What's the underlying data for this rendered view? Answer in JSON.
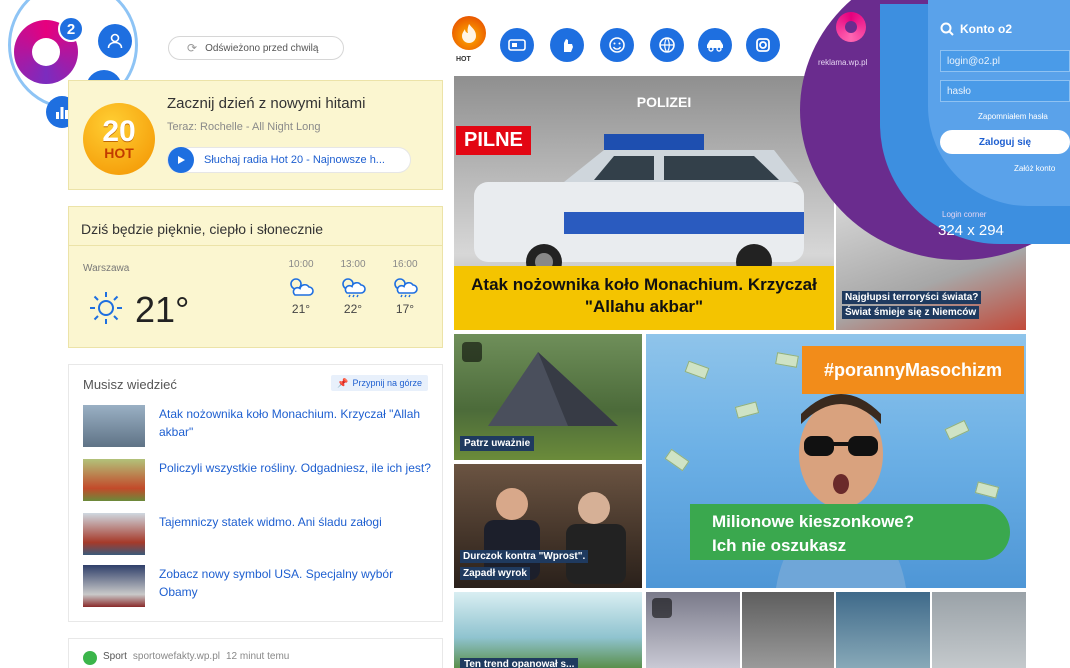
{
  "header": {
    "logo_badge": "2",
    "refresh_label": "Odświeżono przed chwilą"
  },
  "radio": {
    "logo_number": "20",
    "logo_text": "HOT",
    "title": "Zacznij dzień z nowymi hitami",
    "now_playing": "Teraz: Rochelle - All Night Long",
    "play_label": "Słuchaj radia Hot 20 - Najnowsze h..."
  },
  "weather": {
    "title": "Dziś będzie pięknie, ciepło i słonecznie",
    "city": "Warszawa",
    "temp": "21°",
    "hours": [
      {
        "time": "10:00",
        "temp": "21°"
      },
      {
        "time": "13:00",
        "temp": "22°"
      },
      {
        "time": "16:00",
        "temp": "17°"
      }
    ]
  },
  "news": {
    "title": "Musisz wiedzieć",
    "pin_label": "Przypnij na górze",
    "items": [
      {
        "text": "Atak nożownika koło Monachium. Krzyczał \"Allah akbar\"",
        "thumb_color": "#6f7f90"
      },
      {
        "text": "Policzyli wszystkie rośliny. Odgadniesz, ile ich jest?",
        "thumb_color": "#7a8f4a"
      },
      {
        "text": "Tajemniczy statek widmo. Ani śladu załogi",
        "thumb_color": "#8a4a3a"
      },
      {
        "text": "Zobacz nowy symbol USA. Specjalny wybór Obamy",
        "thumb_color": "#3a4f7a"
      }
    ]
  },
  "sport": {
    "label": "Sport",
    "source": "sportowefakty.wp.pl",
    "time": "12 minut temu"
  },
  "topbar": {
    "hot_label": "HOT",
    "icons": [
      "video-icon",
      "hand-icon",
      "smile-icon",
      "ball-icon",
      "car-icon",
      "gear-icon"
    ]
  },
  "tiles": {
    "police_badge": "PILNE",
    "police_caption": "Atak nożownika koło Monachium. Krzyczał \"Allahu akbar\"",
    "police_sign": "POLIZEI",
    "terror_caption_1": "Najgłupsi terroryści świata?",
    "terror_caption_2": "Świat śmieje się z Niemców",
    "tent_caption": "Patrz uważnie",
    "court_caption_1": "Durczok kontra \"Wprost\".",
    "court_caption_2": "Zapadł wyrok",
    "money_hashtag": "#porannyMasochizm",
    "money_caption_1": "Milionowe kieszonkowe?",
    "money_caption_2": "Ich nie oszukasz",
    "fridge_caption": "Ten trend opanował s..."
  },
  "login": {
    "ad_label": "reklama.wp.pl",
    "title": "Konto o2",
    "login_placeholder": "login@o2.pl",
    "password_placeholder": "hasło",
    "forgot": "Zapomniałem hasła",
    "button": "Zaloguj się",
    "create": "Załóż konto",
    "corner_label": "Login corner",
    "corner_size": "324 x 294"
  },
  "colors": {
    "accent": "#1e6fe0",
    "card_yellow": "#fbf6d0",
    "badge_red": "#e30613",
    "caption_yellow": "#f4c400",
    "hashtag_orange": "#f28c1a",
    "caption_green": "#3aa84e",
    "corner_purple": "#6a2c8e"
  }
}
